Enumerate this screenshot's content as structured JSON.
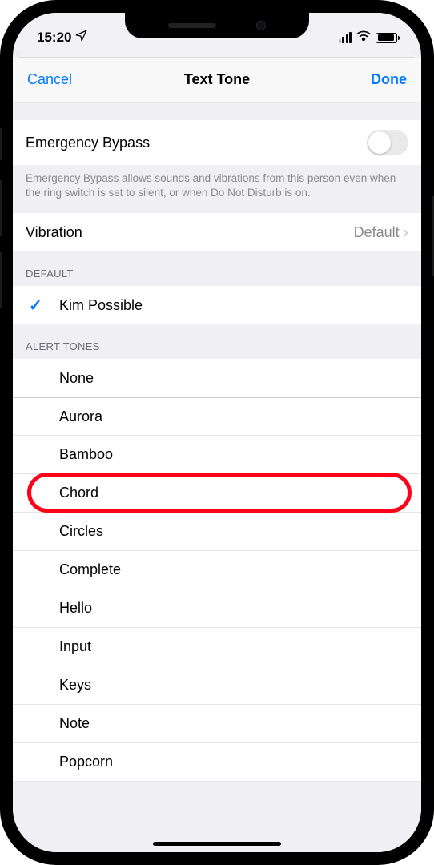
{
  "status": {
    "time": "15:20"
  },
  "nav": {
    "cancel": "Cancel",
    "title": "Text Tone",
    "done": "Done"
  },
  "emergency": {
    "label": "Emergency Bypass",
    "on": false,
    "footer": "Emergency Bypass allows sounds and vibrations from this person even when the ring switch is set to silent, or when Do Not Disturb is on."
  },
  "vibration": {
    "label": "Vibration",
    "value": "Default"
  },
  "default_section": {
    "header": "DEFAULT",
    "selected": "Kim Possible"
  },
  "alert_section": {
    "header": "ALERT TONES",
    "items": [
      "None",
      "Aurora",
      "Bamboo",
      "Chord",
      "Circles",
      "Complete",
      "Hello",
      "Input",
      "Keys",
      "Note",
      "Popcorn"
    ]
  },
  "highlighted_item": "Chord"
}
